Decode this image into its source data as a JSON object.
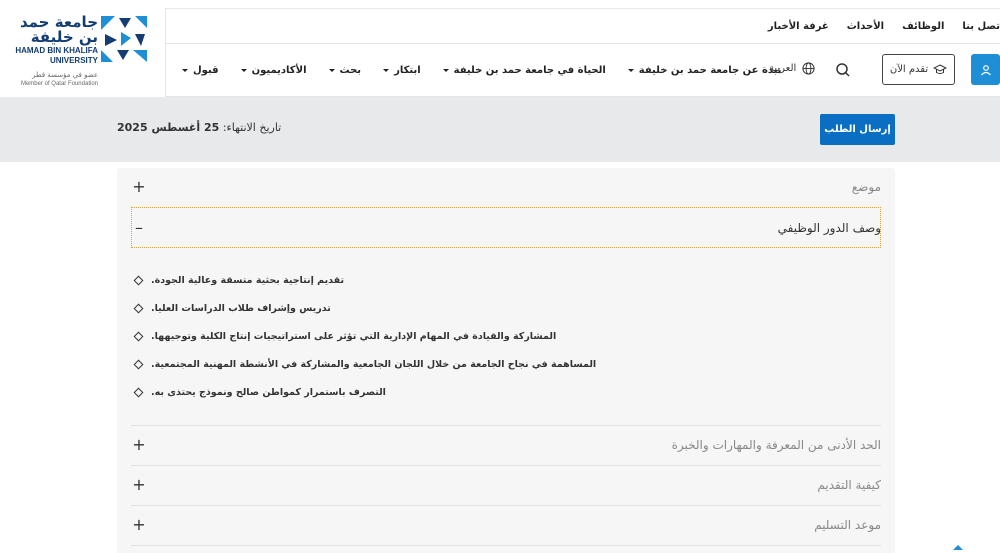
{
  "logo": {
    "name_ar": "جامعة حمد بن خليفة",
    "name_en_line1": "HAMAD BIN KHALIFA",
    "name_en_line2": "UNIVERSITY",
    "member_ar": "عضو في مؤسسة قطر",
    "member_en": "Member of Qatar Foundation",
    "brand_color": "#133d74"
  },
  "utility_nav": {
    "items": [
      "تصل بنا",
      "الوظائف",
      "الأحداث",
      "غرفة الأخبار"
    ]
  },
  "main_nav": {
    "items": [
      {
        "label": "قبول"
      },
      {
        "label": "الأكاديميون"
      },
      {
        "label": "بحث"
      },
      {
        "label": "ابتكار"
      },
      {
        "label": "الحياة في جامعة حمد بن خليفة"
      },
      {
        "label": "نبذة عن جامعة حمد بن خليفة"
      }
    ],
    "language_label": "العربية",
    "apply_label": "تقدم الآن",
    "search_icon": "search-icon",
    "user_icon": "user-icon"
  },
  "job_bar": {
    "submit_label": "إرسال الطلب",
    "deadline_label": "تاريخ الانتهاء:",
    "deadline_value": "25 أغسطس 2025"
  },
  "accordion": {
    "sections": [
      {
        "title": "موضع",
        "open": false
      },
      {
        "title": "وصف الدور الوظيفي",
        "open": true
      },
      {
        "title": "الحد الأدنى من المعرفة والمهارات والخبرة",
        "open": false
      },
      {
        "title": "كيفية التقديم",
        "open": false
      },
      {
        "title": "موعد التسليم",
        "open": false
      }
    ],
    "role_bullets": [
      ".تقديم إنتاجية بحثية متسقة وعالية الجودة",
      ".تدريس وإشراف طلاب الدراسات العليا",
      ".المشاركة والقيادة في المهام الإدارية التي تؤثر على استراتيجيات إنتاج الكلية وتوجيهها",
      ".المساهمة في نجاح الجامعة من خلال اللجان الجامعية والمشاركة في الأنشطة المهنية المجتمعية",
      ".التصرف باستمرار كمواطن صالح ونموذج يحتذى به"
    ],
    "expand_symbol": "+",
    "collapse_symbol": "–"
  },
  "colors": {
    "accent_blue": "#0a6fc2",
    "user_button": "#1e8fd6",
    "band_gray": "#e8e9ea"
  }
}
